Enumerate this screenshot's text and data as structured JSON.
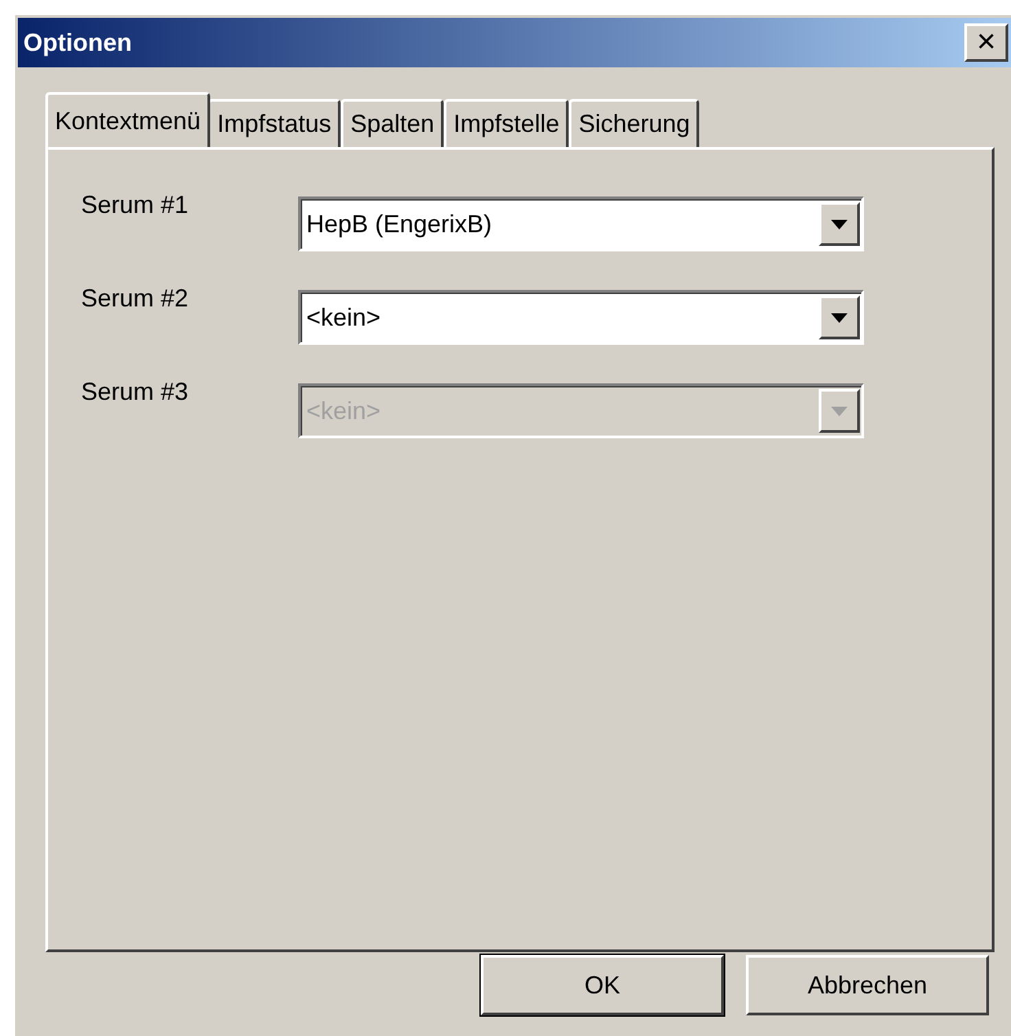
{
  "window": {
    "title": "Optionen",
    "close": "×"
  },
  "tabs": [
    {
      "label": "Kontextmenü",
      "selected": true
    },
    {
      "label": "Impfstatus",
      "selected": false
    },
    {
      "label": "Spalten",
      "selected": false
    },
    {
      "label": "Impfstelle",
      "selected": false
    },
    {
      "label": "Sicherung",
      "selected": false
    }
  ],
  "fields": [
    {
      "label": "Serum #1",
      "value": "HepB (EngerixB)",
      "disabled": false
    },
    {
      "label": "Serum #2",
      "value": "<kein>",
      "disabled": false
    },
    {
      "label": "Serum #3",
      "value": "<kein>",
      "disabled": true
    }
  ],
  "buttons": [
    {
      "label": "OK",
      "default": true
    },
    {
      "label": "Abbrechen",
      "default": false
    }
  ]
}
